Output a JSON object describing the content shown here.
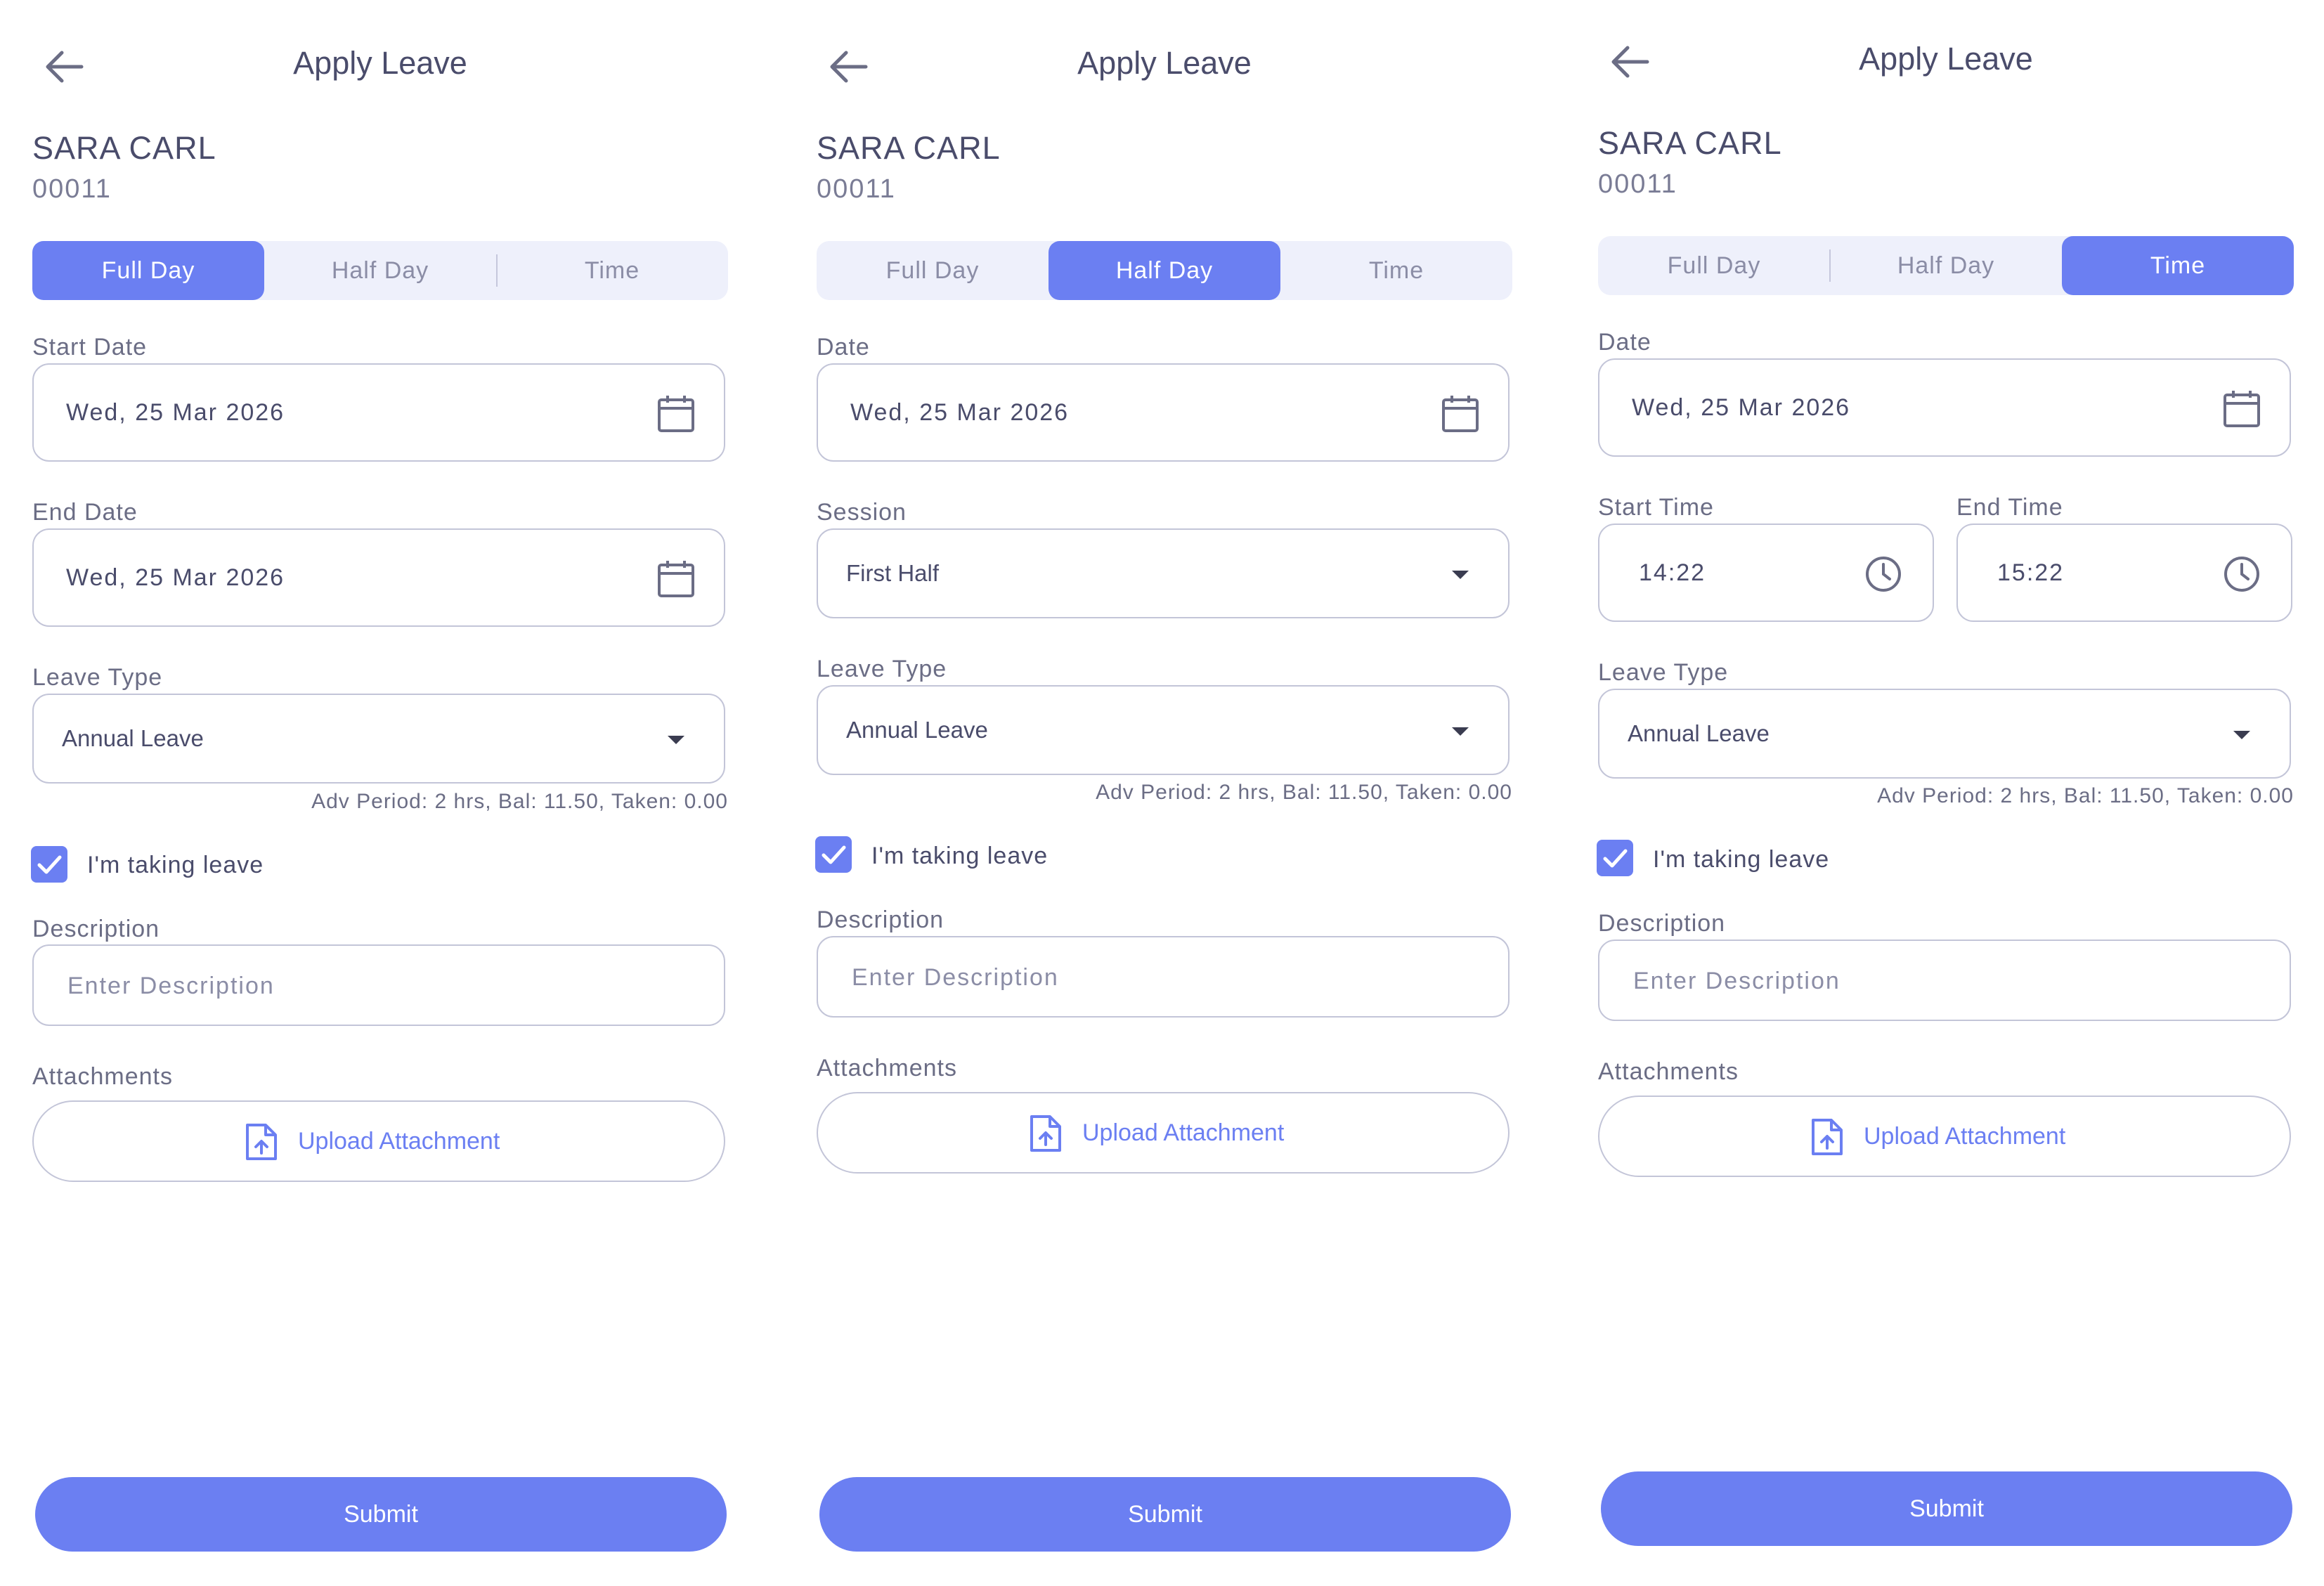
{
  "header": {
    "title": "Apply Leave"
  },
  "employee": {
    "name": "SARA CARL",
    "id": "00011"
  },
  "tabs": {
    "full_day": "Full Day",
    "half_day": "Half Day",
    "time": "Time"
  },
  "screens": [
    {
      "active_tab": "Full Day",
      "start_date_label": "Start Date",
      "start_date_value": "Wed, 25 Mar 2026",
      "end_date_label": "End Date",
      "end_date_value": "Wed, 25 Mar 2026"
    },
    {
      "active_tab": "Half Day",
      "date_label": "Date",
      "date_value": "Wed, 25 Mar 2026",
      "session_label": "Session",
      "session_value": "First Half"
    },
    {
      "active_tab": "Time",
      "date_label": "Date",
      "date_value": "Wed, 25 Mar 2026",
      "start_time_label": "Start Time",
      "start_time_value": "14:22",
      "end_time_label": "End Time",
      "end_time_value": "15:22"
    }
  ],
  "leave_type": {
    "label": "Leave Type",
    "value": "Annual Leave"
  },
  "balance_hint": "Adv Period: 2 hrs, Bal: 11.50, Taken: 0.00",
  "taking_leave": {
    "label": "I'm taking leave",
    "checked": true
  },
  "description": {
    "label": "Description",
    "placeholder": "Enter Description"
  },
  "attachments": {
    "label": "Attachments",
    "button": "Upload Attachment"
  },
  "submit": {
    "label": "Submit"
  },
  "colors": {
    "accent": "#6b7ff2",
    "text": "#4a4c6b",
    "border": "#c3c5d8",
    "segment_bg": "#eef0fb"
  },
  "icons": [
    "arrow-left-icon",
    "calendar-icon",
    "clock-icon",
    "caret-down-icon",
    "check-icon",
    "file-upload-icon"
  ]
}
